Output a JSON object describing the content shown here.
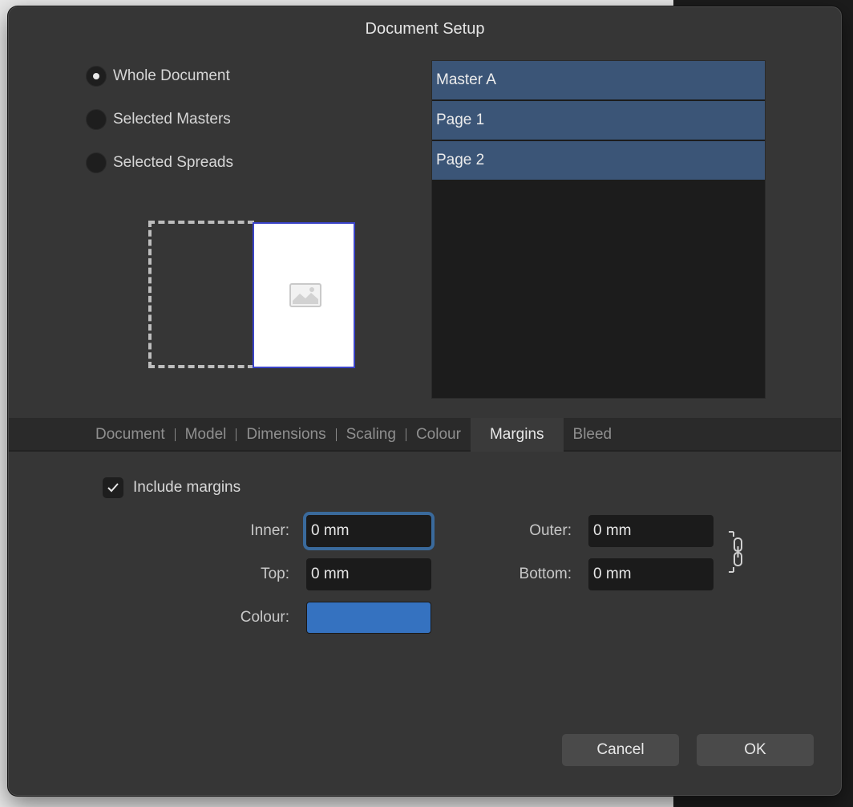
{
  "dialog": {
    "title": "Document Setup"
  },
  "scope": {
    "options": [
      {
        "label": "Whole Document",
        "selected": true
      },
      {
        "label": "Selected Masters",
        "selected": false
      },
      {
        "label": "Selected Spreads",
        "selected": false
      }
    ]
  },
  "pages": {
    "items": [
      "Master A",
      "Page 1",
      "Page 2"
    ]
  },
  "tabs": {
    "items": [
      "Document",
      "Model",
      "Dimensions",
      "Scaling",
      "Colour",
      "Margins",
      "Bleed"
    ],
    "active": "Margins"
  },
  "margins": {
    "include_label": "Include margins",
    "include_checked": true,
    "inner_label": "Inner:",
    "inner_value": "0 mm",
    "outer_label": "Outer:",
    "outer_value": "0 mm",
    "top_label": "Top:",
    "top_value": "0 mm",
    "bottom_label": "Bottom:",
    "bottom_value": "0 mm",
    "colour_label": "Colour:",
    "colour_value": "#3572c0"
  },
  "buttons": {
    "cancel": "Cancel",
    "ok": "OK"
  },
  "colors": {
    "dialog_bg": "#363636",
    "list_selected": "#3b5577",
    "focus_ring": "#3a6a9c"
  }
}
